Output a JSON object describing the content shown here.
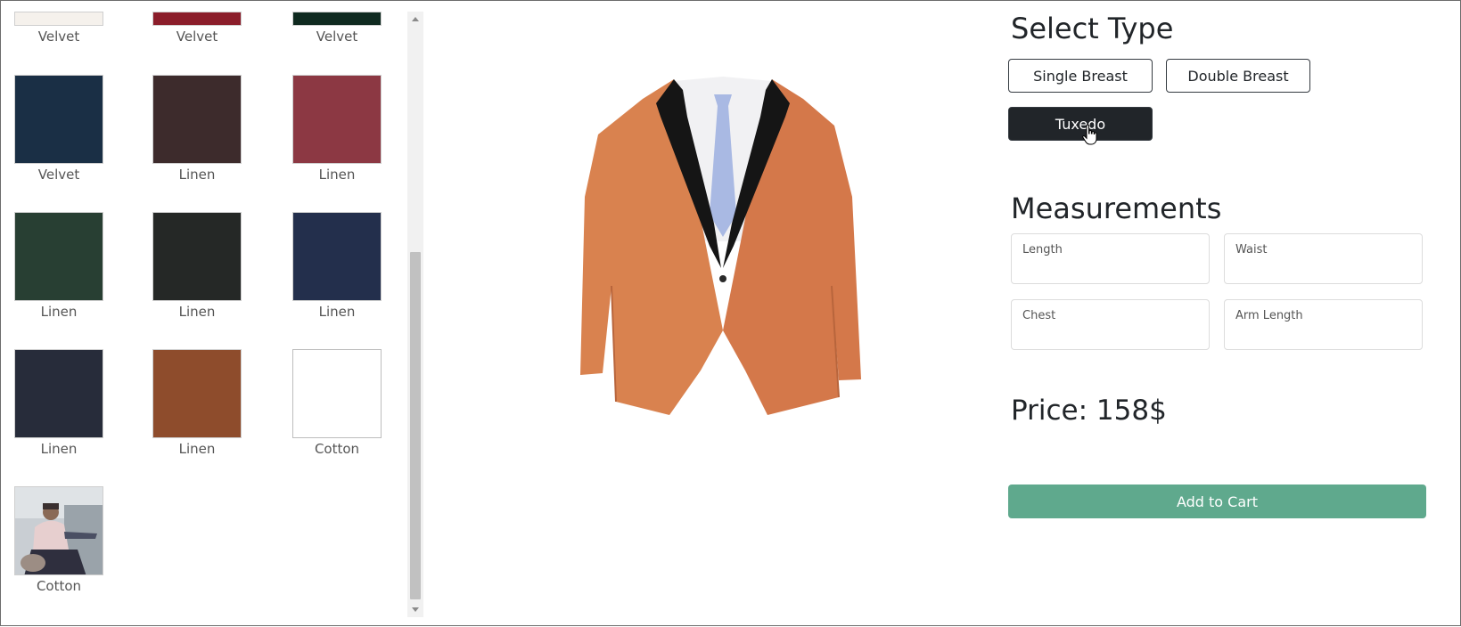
{
  "fabrics": [
    {
      "label": "Velvet",
      "color": "#f5f1ec"
    },
    {
      "label": "Velvet",
      "color": "#8b1d2a"
    },
    {
      "label": "Velvet",
      "color": "#0f2a20"
    },
    {
      "label": "Velvet",
      "color": "#1a2f45"
    },
    {
      "label": "Linen",
      "color": "#3d2b2c"
    },
    {
      "label": "Linen",
      "color": "#8c3843"
    },
    {
      "label": "Linen",
      "color": "#283f33"
    },
    {
      "label": "Linen",
      "color": "#252826"
    },
    {
      "label": "Linen",
      "color": "#232f4c"
    },
    {
      "label": "Linen",
      "color": "#272c3a"
    },
    {
      "label": "Linen",
      "color": "#8e4c2c"
    },
    {
      "label": "Cotton",
      "color": "#ffffff"
    },
    {
      "label": "Cotton",
      "color": "photo"
    }
  ],
  "select_type": {
    "title": "Select Type",
    "options": [
      "Single Breast",
      "Double Breast",
      "Tuxedo"
    ],
    "selected": "Tuxedo"
  },
  "measurements": {
    "title": "Measurements",
    "length_label": "Length",
    "waist_label": "Waist",
    "chest_label": "Chest",
    "arm_length_label": "Arm Length"
  },
  "price_text": "Price: 158$",
  "add_to_cart_label": "Add to Cart",
  "preview": {
    "jacket_color": "#d9824f",
    "lapel_color": "#151515",
    "tie_color": "#a9b9e3"
  },
  "colors": {
    "primary_dark": "#212529",
    "cart_green": "#5fa98d"
  }
}
